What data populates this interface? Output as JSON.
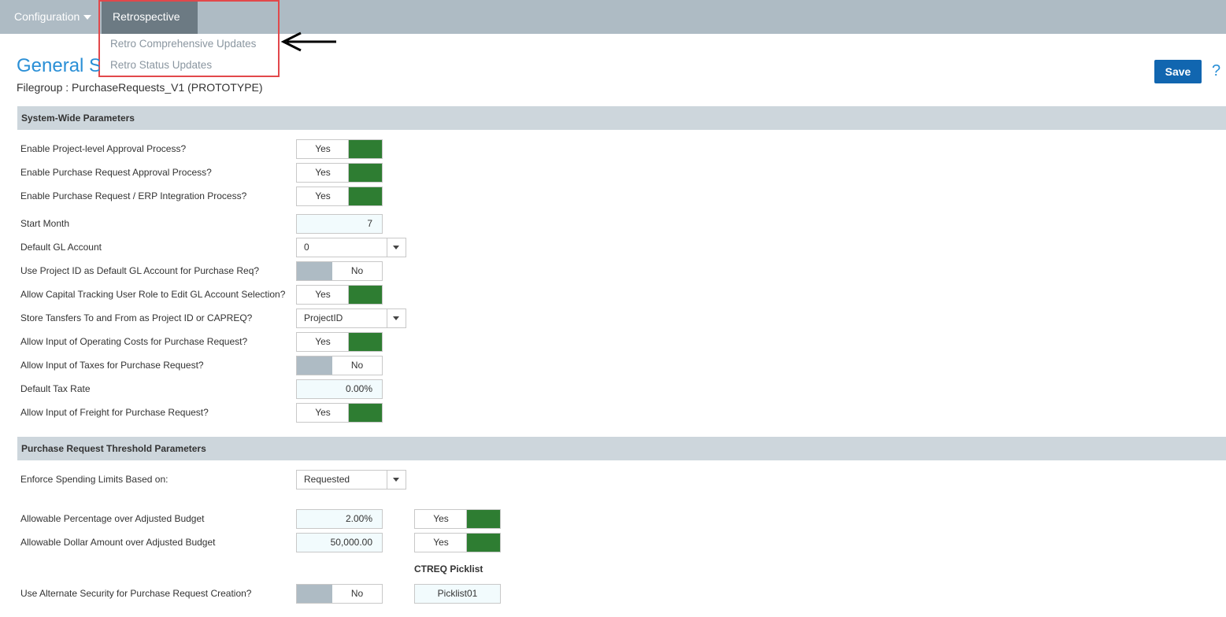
{
  "nav": {
    "configuration": "Configuration",
    "retrospective": "Retrospective",
    "retro_menu": [
      "Retro Comprehensive Updates",
      "Retro Status Updates"
    ]
  },
  "page": {
    "title": "General S",
    "filegroup": "Filegroup : PurchaseRequests_V1 (PROTOTYPE)",
    "save_label": "Save",
    "help_label": "?"
  },
  "sections": {
    "system_wide": "System-Wide Parameters",
    "threshold": "Purchase Request Threshold Parameters"
  },
  "fields": {
    "project_approval": {
      "label": "Enable Project-level Approval Process?",
      "value": "Yes"
    },
    "pr_approval": {
      "label": "Enable Purchase Request Approval Process?",
      "value": "Yes"
    },
    "erp_integration": {
      "label": "Enable Purchase Request / ERP Integration Process?",
      "value": "Yes"
    },
    "start_month": {
      "label": "Start Month",
      "value": "7"
    },
    "default_gl": {
      "label": "Default GL Account",
      "value": "0"
    },
    "project_id_gl": {
      "label": "Use Project ID as Default GL Account for Purchase Req?",
      "value": "No"
    },
    "capital_tracking": {
      "label": "Allow Capital Tracking User Role to Edit GL Account Selection?",
      "value": "Yes"
    },
    "store_transfers": {
      "label": "Store Tansfers To and From as Project ID or CAPREQ?",
      "value": "ProjectID"
    },
    "operating_costs": {
      "label": "Allow Input of Operating Costs for Purchase Request?",
      "value": "Yes"
    },
    "taxes": {
      "label": "Allow Input of Taxes for Purchase Request?",
      "value": "No"
    },
    "tax_rate": {
      "label": "Default Tax Rate",
      "value": "0.00%"
    },
    "freight": {
      "label": "Allow Input of Freight for Purchase Request?",
      "value": "Yes"
    },
    "spending_limits": {
      "label": "Enforce Spending Limits Based on:",
      "value": "Requested"
    },
    "pct_over_budget": {
      "label": "Allowable Percentage over Adjusted Budget",
      "value": "2.00%",
      "toggle": "Yes"
    },
    "dollar_over_budget": {
      "label": "Allowable Dollar Amount over Adjusted Budget",
      "value": "50,000.00",
      "toggle": "Yes"
    },
    "alt_security": {
      "label": "Use Alternate Security for Purchase Request Creation?",
      "value": "No"
    }
  },
  "ctreq": {
    "label": "CTREQ Picklist",
    "value": "Picklist01"
  },
  "colors": {
    "accent": "#2a8fd6",
    "toggle_on": "#2e7d32",
    "toggle_off": "#aebbc4",
    "save": "#1166b0",
    "highlight": "#e2484b",
    "topbar": "#aebbc4"
  }
}
